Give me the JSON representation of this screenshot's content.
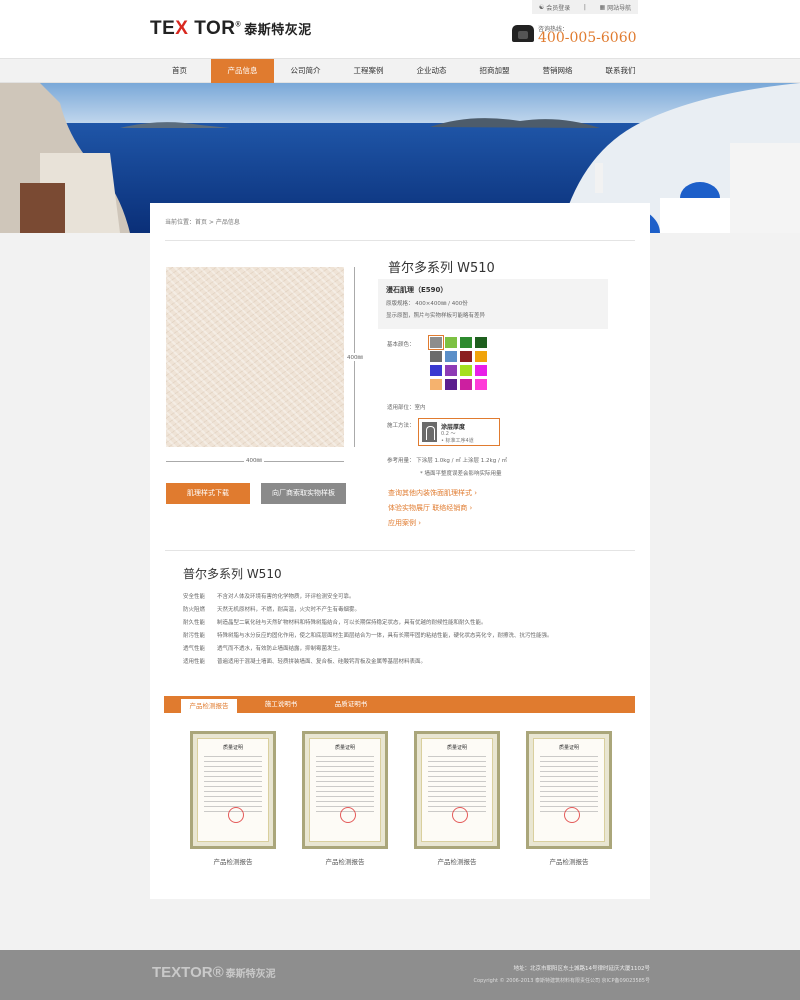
{
  "header": {
    "logo_text": "TE",
    "logo_x": "X",
    "logo_tor": "TOR",
    "logo_reg": "®",
    "logo_cn": "泰斯特灰泥",
    "top_links": [
      "会员登录",
      "网站导航"
    ],
    "hotline_label": "咨询热线：",
    "hotline_number": "400-005-6060"
  },
  "nav": {
    "items": [
      "首页",
      "产品信息",
      "公司简介",
      "工程案例",
      "企业动态",
      "招商加盟",
      "营销网络",
      "联系我们"
    ],
    "active_index": 1
  },
  "breadcrumb": "当前位置：首页 > 产品信息",
  "product": {
    "title": "普尔多系列 W510",
    "spec_name": "漫石肌理（E590）",
    "spec_size": "原版规格：  400×400㎜  /  400份",
    "spec_note": "显示原图，照片与实物样板可能略有差异",
    "dim_vertical": "400㎜",
    "dim_horizontal": "400㎜",
    "download_button": "肌理样式下载",
    "sample_button": "向厂商索取实物样板",
    "color_label": "基本颜色：",
    "colors": [
      "#8d8d8d",
      "#7dc143",
      "#2d8a2e",
      "#1e5f1e",
      "#6c6c6c",
      "#5b8fc8",
      "#8b1f1f",
      "#f0a30a",
      "#3a3ad0",
      "#8e3bb5",
      "#a4e01f",
      "#e81fe8",
      "#f5b26e",
      "#5c1f8f",
      "#cc1fa0",
      "#ff3ad8"
    ],
    "selected_color": 0,
    "area_label": "适用部位：室内",
    "method_label": "施工方法：",
    "method_title": "涂层厚度",
    "method_a": "0.2 ～",
    "method_b": "• 标准工序4道",
    "usage": "参考用量：  下涂层    1.0kg / ㎡        上涂层    1.2kg / ㎡",
    "usage_note": "* 墙面平整度误差会影响实际用量",
    "links": [
      "查询其他内装饰面肌理样式 ›",
      "体验实物展厅  联络经销商 ›",
      "应用案例 ›"
    ]
  },
  "description": {
    "title": "普尔多系列 W510",
    "rows": [
      {
        "k": "安全性能",
        "v": "不含对人体及环境有害的化学物质，环评检测安全可靠。"
      },
      {
        "k": "防火阻燃",
        "v": "天然无机原材料，不燃，耐高温，火灾时不产生有毒烟雾。"
      },
      {
        "k": "耐久性能",
        "v": "制造晶型二氧化硅与天然矿物材料和特殊树脂结合，可以长期保持稳定状态，具有优越的耐候性能和耐久性能。"
      },
      {
        "k": "耐污性能",
        "v": "特殊树脂与水分反应的固化作用，使之和底层面材生面层结合为一体，具有长期牢固的粘结性能，硬化状态亮化令，耐擦洗、抗污性能强。"
      },
      {
        "k": "透气性能",
        "v": "透气而不透水，有效防止墙面结露，抑制霉菌发生。"
      },
      {
        "k": "适用性能",
        "v": "普遍适用于混凝土墙面、轻质拼装墙面、复合板、硅酸钙背板及金属等基层材料表面。"
      }
    ]
  },
  "tabs": [
    "产品检测报告",
    "施工说明书",
    "品质证明书"
  ],
  "active_tab": 0,
  "certificates": {
    "heading": "质量证明",
    "labels": [
      "产品检测报告",
      "产品检测报告",
      "产品检测报告",
      "产品检测报告"
    ]
  },
  "footer": {
    "logo_text": "TEXTOR®",
    "logo_cn": "泰斯特灰泥",
    "address": "地址：北京市朝阳区东土城路14号律时延庆大厦1102号",
    "copyright": "Copyright © 2006-2013  泰斯特建筑材料有限责任公司    京ICP备09023585号"
  }
}
